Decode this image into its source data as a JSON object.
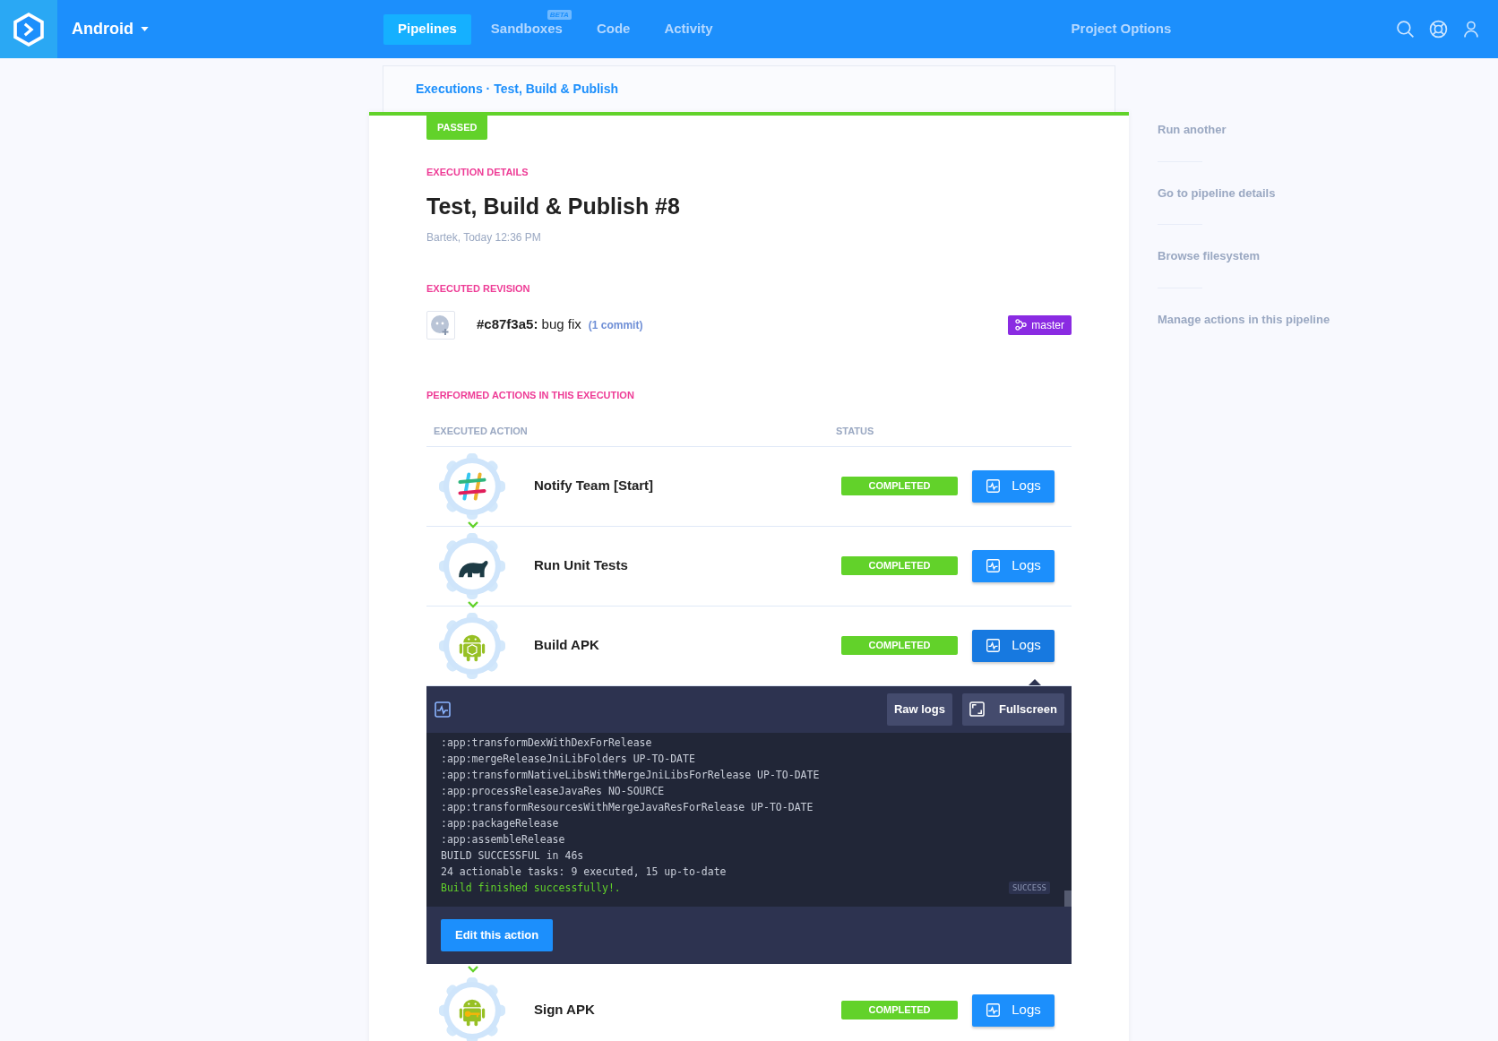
{
  "header": {
    "project": "Android",
    "nav": [
      {
        "label": "Pipelines",
        "selected": true
      },
      {
        "label": "Sandboxes",
        "selected": false,
        "badge": "BETA"
      },
      {
        "label": "Code",
        "selected": false
      },
      {
        "label": "Activity",
        "selected": false
      }
    ],
    "project_options": "Project Options"
  },
  "breadcrumb": "Executions · Test, Build & Publish",
  "status_badge": "PASSED",
  "details": {
    "section": "EXECUTION DETAILS",
    "title": "Test, Build & Publish #8",
    "meta": "Bartek, Today 12:36 PM"
  },
  "revision": {
    "section": "EXECUTED REVISION",
    "hash": "#c87f3a5:",
    "message": "bug fix",
    "commits": "(1 commit)",
    "branch": "master"
  },
  "actions": {
    "section": "PERFORMED ACTIONS IN THIS EXECUTION",
    "columns": [
      "EXECUTED ACTION",
      "STATUS"
    ],
    "rows": [
      {
        "kind": "slack",
        "name": "Notify Team [Start]",
        "status": "COMPLETED",
        "logs": "Logs",
        "selected": false
      },
      {
        "kind": "gradle",
        "name": "Run Unit Tests",
        "status": "COMPLETED",
        "logs": "Logs",
        "selected": false
      },
      {
        "kind": "android",
        "name": "Build APK",
        "status": "COMPLETED",
        "logs": "Logs",
        "selected": true
      },
      {
        "kind": "android-key",
        "name": "Sign APK",
        "status": "COMPLETED",
        "logs": "Logs",
        "selected": false
      }
    ]
  },
  "log_panel": {
    "buttons": [
      "Raw logs",
      "Fullscreen"
    ],
    "lines": [
      {
        "kind": "plain",
        "text": ":app:transformDexWithDexForRelease"
      },
      {
        "kind": "plain",
        "text": ":app:mergeReleaseJniLibFolders UP-TO-DATE"
      },
      {
        "kind": "plain",
        "text": ":app:transformNativeLibsWithMergeJniLibsForRelease UP-TO-DATE"
      },
      {
        "kind": "plain",
        "text": ":app:processReleaseJavaRes NO-SOURCE"
      },
      {
        "kind": "plain",
        "text": ":app:transformResourcesWithMergeJavaResForRelease UP-TO-DATE"
      },
      {
        "kind": "plain",
        "text": ":app:packageRelease"
      },
      {
        "kind": "plain",
        "text": ":app:assembleRelease"
      },
      {
        "kind": "plain",
        "text": "BUILD SUCCESSFUL in 46s"
      },
      {
        "kind": "plain",
        "text": "24 actionable tasks: 9 executed, 15 up-to-date"
      },
      {
        "kind": "success",
        "text": "Build finished successfully!."
      }
    ],
    "result_badge": "SUCCESS",
    "edit_button": "Edit this action"
  },
  "sidebar": [
    "Run another",
    "Go to pipeline details",
    "Browse filesystem",
    "Manage actions in this pipeline"
  ]
}
